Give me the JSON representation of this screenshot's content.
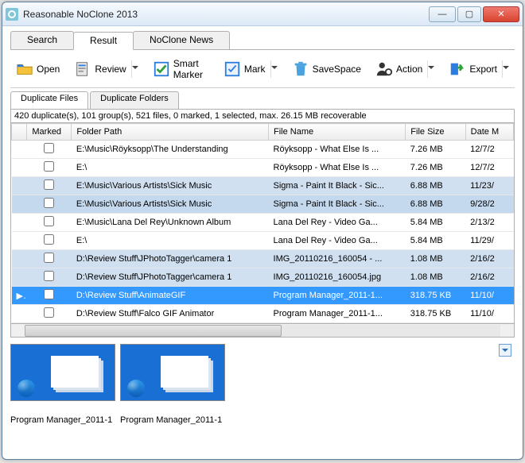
{
  "title": "Reasonable NoClone 2013",
  "tabs": {
    "search": "Search",
    "result": "Result",
    "news": "NoClone News"
  },
  "toolbar": {
    "open": "Open",
    "review": "Review",
    "smartmarker": "Smart Marker",
    "mark": "Mark",
    "savespace": "SaveSpace",
    "action": "Action",
    "export": "Export"
  },
  "subtabs": {
    "files": "Duplicate Files",
    "folders": "Duplicate Folders"
  },
  "status": "420 duplicate(s), 101 group(s), 521 files, 0 marked, 1 selected, max. 26.15 MB recoverable",
  "columns": {
    "marked": "Marked",
    "folder": "Folder Path",
    "filename": "File Name",
    "size": "File Size",
    "date": "Date M"
  },
  "rows": [
    {
      "folder": "E:\\Music\\Röyksopp\\The Understanding",
      "file": "Röyksopp - What Else Is ...",
      "size": "7.26 MB",
      "date": "12/7/2",
      "class": ""
    },
    {
      "folder": "E:\\",
      "file": "Röyksopp - What Else Is ...",
      "size": "7.26 MB",
      "date": "12/7/2",
      "class": ""
    },
    {
      "folder": "E:\\Music\\Various Artists\\Sick Music",
      "file": "Sigma - Paint It Black - Sic...",
      "size": "6.88 MB",
      "date": "11/23/",
      "class": "alt"
    },
    {
      "folder": "E:\\Music\\Various Artists\\Sick Music",
      "file": "Sigma - Paint It Black - Sic...",
      "size": "6.88 MB",
      "date": "9/28/2",
      "class": "alt2"
    },
    {
      "folder": "E:\\Music\\Lana Del Rey\\Unknown Album",
      "file": "Lana Del Rey - Video Ga...",
      "size": "5.84 MB",
      "date": "2/13/2",
      "class": ""
    },
    {
      "folder": "E:\\",
      "file": "Lana Del Rey - Video Ga...",
      "size": "5.84 MB",
      "date": "11/29/",
      "class": ""
    },
    {
      "folder": "D:\\Review Stuff\\JPhotoTagger\\camera 1",
      "file": "IMG_20110216_160054 - ...",
      "size": "1.08 MB",
      "date": "2/16/2",
      "class": "alt"
    },
    {
      "folder": "D:\\Review Stuff\\JPhotoTagger\\camera 1",
      "file": "IMG_20110216_160054.jpg",
      "size": "1.08 MB",
      "date": "2/16/2",
      "class": "alt"
    },
    {
      "folder": "D:\\Review Stuff\\AnimateGIF",
      "file": "Program Manager_2011-1...",
      "size": "318.75 KB",
      "date": "11/10/",
      "class": "sel"
    },
    {
      "folder": "D:\\Review Stuff\\Falco GIF Animator",
      "file": "Program Manager_2011-1...",
      "size": "318.75 KB",
      "date": "11/10/",
      "class": ""
    }
  ],
  "captions": {
    "a": "Program Manager_2011-1",
    "b": "Program Manager_2011-1"
  }
}
